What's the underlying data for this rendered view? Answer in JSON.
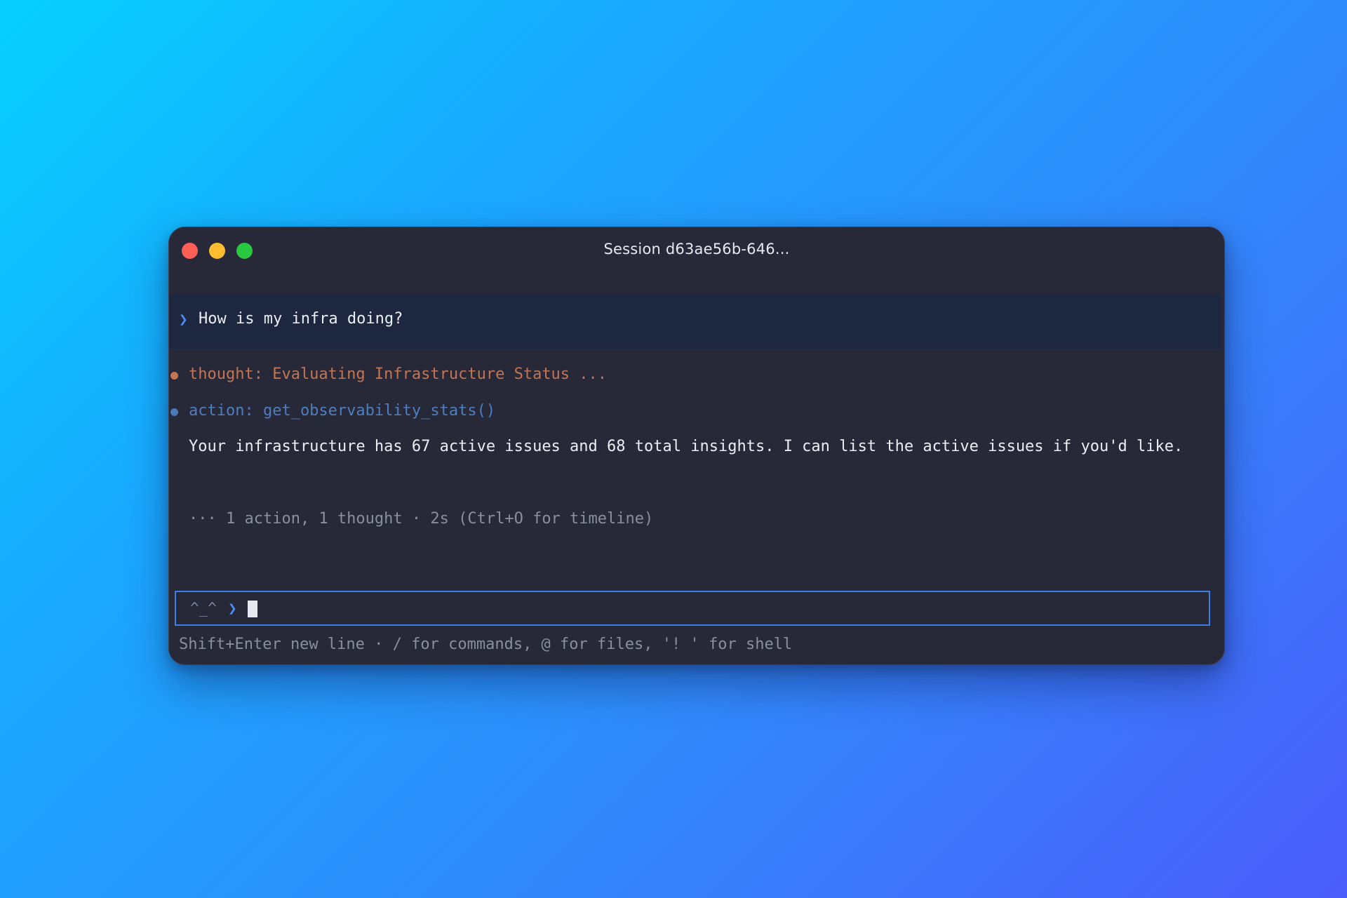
{
  "window": {
    "title": "Session d63ae56b-646..."
  },
  "conversation": {
    "user_prompt_icon": "chevron-right-icon",
    "user_prompt_glyph": "❯",
    "user_message": "How is my infra doing?",
    "thought": "thought: Evaluating Infrastructure Status ...",
    "action": "action: get_observability_stats()",
    "response": "Your infrastructure has 67 active issues and 68 total insights. I can list the active issues if you'd like.",
    "summary": "··· 1 action, 1 thought · 2s (Ctrl+O for timeline)"
  },
  "input": {
    "kaomoji": "^_^",
    "prompt_glyph": "❯",
    "value": ""
  },
  "hint": {
    "text": "Shift+Enter new line · / for commands, @ for files, '! ' for shell"
  },
  "colors": {
    "background_gradient_start": "#06d0fd",
    "background_gradient_end": "#4c5dfb",
    "window_bg": "#272838",
    "user_row_bg": "#1d2740",
    "accent": "#3c7eea",
    "thought": "#c47553",
    "action": "#4d7fc0",
    "close": "#fe5f57",
    "minimize": "#febc2e",
    "maximize": "#28c840"
  }
}
